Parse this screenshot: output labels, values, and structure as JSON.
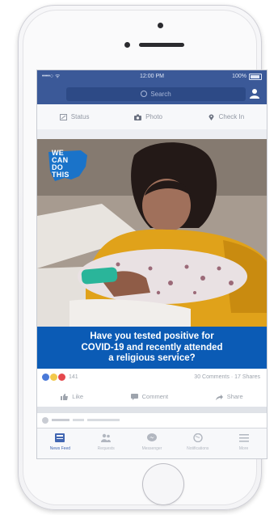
{
  "statusbar": {
    "carrier": "••••○ ᯤ",
    "time": "12:00 PM",
    "battery": "100%"
  },
  "search": {
    "placeholder": "Search"
  },
  "composer": {
    "status": "Status",
    "photo": "Photo",
    "checkin": "Check In"
  },
  "logo": {
    "line1": "WE",
    "line2": "CAN",
    "line3": "DO",
    "line4": "THIS"
  },
  "caption": {
    "line1": "Have you tested positive for",
    "line2": "COVID-19 and recently attended",
    "line3": "a religious service?"
  },
  "reactions": {
    "count": "141",
    "summary": "30 Comments · 17 Shares"
  },
  "actions": {
    "like": "Like",
    "comment": "Comment",
    "share": "Share"
  },
  "tabs": [
    {
      "label": "News Feed"
    },
    {
      "label": "Requests"
    },
    {
      "label": "Messenger"
    },
    {
      "label": "Notifications"
    },
    {
      "label": "More"
    }
  ],
  "colors": {
    "brand": "#3b5998",
    "caption_bg": "#0b5bb5",
    "logo_blue": "#1a73c9"
  }
}
